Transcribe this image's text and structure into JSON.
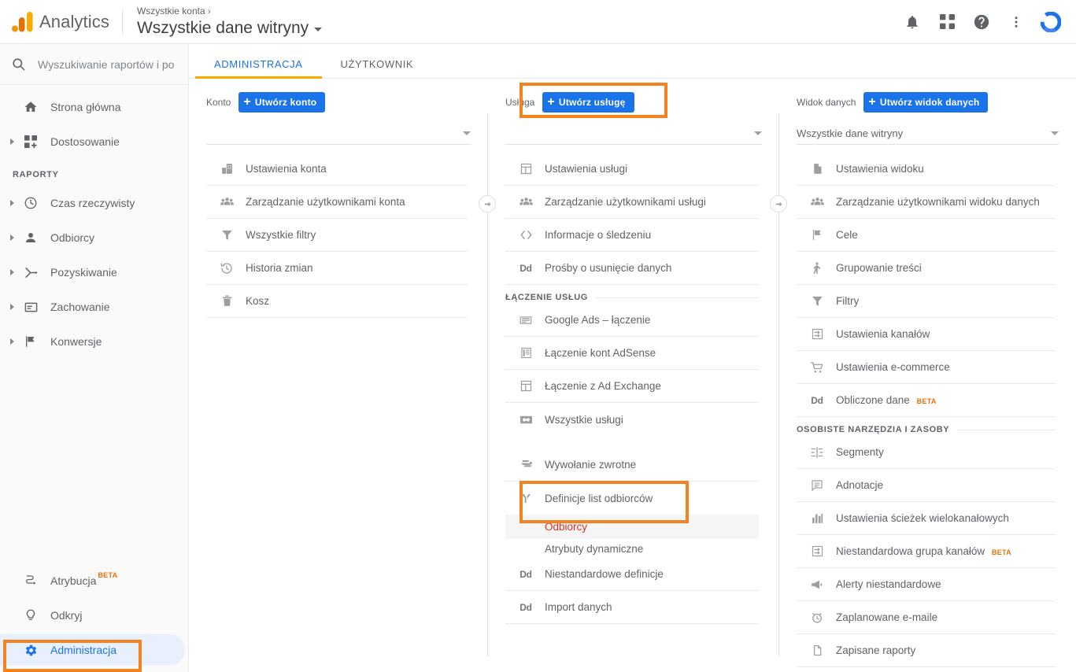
{
  "app": {
    "brand": "Analytics",
    "breadcrumb": "Wszystkie konta",
    "breadcrumb_chevron": "›",
    "view_title": "Wszystkie dane witryny",
    "accent_blue": "#1a73e8",
    "accent_orange": "#f58220",
    "highlight_color": "#f58220",
    "selected_text_color": "#d93025"
  },
  "topbar": {
    "icons": [
      {
        "name": "notifications-icon",
        "label": "Powiadomienia"
      },
      {
        "name": "apps-grid-icon",
        "label": "Aplikacje Google"
      },
      {
        "name": "help-icon",
        "label": "Pomoc"
      },
      {
        "name": "more-vert-icon",
        "label": "Więcej"
      },
      {
        "name": "avatar-icon",
        "label": "Konto Google"
      }
    ]
  },
  "search": {
    "placeholder": "Wyszukiwanie raportów i po",
    "value": ""
  },
  "sidebar": {
    "top_items": [
      {
        "label": "Strona główna",
        "icon": "home-icon",
        "expandable": false
      },
      {
        "label": "Dostosowanie",
        "icon": "customization-icon",
        "expandable": true
      }
    ],
    "section_label": "RAPORTY",
    "report_items": [
      {
        "label": "Czas rzeczywisty",
        "icon": "clock-icon",
        "expandable": true
      },
      {
        "label": "Odbiorcy",
        "icon": "person-icon",
        "expandable": true
      },
      {
        "label": "Pozyskiwanie",
        "icon": "acquisition-icon",
        "expandable": true
      },
      {
        "label": "Zachowanie",
        "icon": "behavior-icon",
        "expandable": true
      },
      {
        "label": "Konwersje",
        "icon": "flag-icon",
        "expandable": true
      }
    ],
    "bottom_items": [
      {
        "label": "Atrybucja",
        "icon": "attribution-icon",
        "badge": "BETA",
        "active": false
      },
      {
        "label": "Odkryj",
        "icon": "lightbulb-icon",
        "badge": "",
        "active": false
      },
      {
        "label": "Administracja",
        "icon": "gear-icon",
        "badge": "",
        "active": true
      }
    ]
  },
  "tabs": [
    {
      "label": "ADMINISTRACJA",
      "active": true
    },
    {
      "label": "UŻYTKOWNIK",
      "active": false
    }
  ],
  "columns": {
    "account": {
      "head_label": "Konto",
      "create_button": "Utwórz konto",
      "selector_value": "",
      "rows": [
        {
          "label": "Ustawienia konta",
          "icon": "building-icon"
        },
        {
          "label": "Zarządzanie użytkownikami konta",
          "icon": "people-icon"
        },
        {
          "label": "Wszystkie filtry",
          "icon": "filter-icon"
        },
        {
          "label": "Historia zmian",
          "icon": "history-icon"
        },
        {
          "label": "Kosz",
          "icon": "trash-icon"
        }
      ]
    },
    "property": {
      "head_label": "Usługa",
      "create_button": "Utwórz usługę",
      "selector_value": "",
      "rows": [
        {
          "label": "Ustawienia usługi",
          "icon": "layout-icon"
        },
        {
          "label": "Zarządzanie użytkownikami usługi",
          "icon": "people-icon"
        },
        {
          "label": "Informacje o śledzeniu",
          "icon": "code-icon"
        },
        {
          "label": "Prośby o usunięcie danych",
          "icon": "dd-icon"
        }
      ],
      "group_label": "ŁĄCZENIE USŁUG",
      "link_rows": [
        {
          "label": "Google Ads – łączenie",
          "icon": "ads-icon"
        },
        {
          "label": "Łączenie kont AdSense",
          "icon": "adsense-icon"
        },
        {
          "label": "Łączenie z Ad Exchange",
          "icon": "layout-icon"
        },
        {
          "label": "Wszystkie usługi",
          "icon": "link-icon"
        }
      ],
      "postback_row": {
        "label": "Wywołanie zwrotne",
        "icon": "postback-icon"
      },
      "audience_row": {
        "label": "Definicje list odbiorców",
        "icon": "branch-icon"
      },
      "audience_subrows": [
        {
          "label": "Odbiorcy",
          "selected": true
        },
        {
          "label": "Atrybuty dynamiczne",
          "selected": false
        }
      ],
      "tail_rows": [
        {
          "label": "Niestandardowe definicje",
          "icon": "dd-icon"
        },
        {
          "label": "Import danych",
          "icon": "dd-icon"
        }
      ]
    },
    "view": {
      "head_label": "Widok danych",
      "create_button": "Utwórz widok danych",
      "selector_value": "Wszystkie dane witryny",
      "rows": [
        {
          "label": "Ustawienia widoku",
          "icon": "document-icon",
          "badge": ""
        },
        {
          "label": "Zarządzanie użytkownikami widoku danych",
          "icon": "people-icon",
          "badge": ""
        },
        {
          "label": "Cele",
          "icon": "flag-icon",
          "badge": ""
        },
        {
          "label": "Grupowanie treści",
          "icon": "content-group-icon",
          "badge": ""
        },
        {
          "label": "Filtry",
          "icon": "filter-icon",
          "badge": ""
        },
        {
          "label": "Ustawienia kanałów",
          "icon": "channel-icon",
          "badge": ""
        },
        {
          "label": "Ustawienia e-commerce",
          "icon": "cart-icon",
          "badge": ""
        },
        {
          "label": "Obliczone dane",
          "icon": "dd-icon",
          "badge": "BETA"
        }
      ],
      "group_label": "OSOBISTE NARZĘDZIA I ZASOBY",
      "tools_rows": [
        {
          "label": "Segmenty",
          "icon": "segments-icon",
          "badge": ""
        },
        {
          "label": "Adnotacje",
          "icon": "annotation-icon",
          "badge": ""
        },
        {
          "label": "Ustawienia ścieżek wielokanałowych",
          "icon": "bars-icon",
          "badge": ""
        },
        {
          "label": "Niestandardowa grupa kanałów",
          "icon": "channel-icon",
          "badge": "BETA"
        },
        {
          "label": "Alerty niestandardowe",
          "icon": "megaphone-icon",
          "badge": ""
        },
        {
          "label": "Zaplanowane e-maile",
          "icon": "alarm-icon",
          "badge": ""
        },
        {
          "label": "Zapisane raporty",
          "icon": "document-icon",
          "badge": ""
        }
      ]
    }
  },
  "highlights": [
    {
      "name": "highlight-create-property",
      "target": "Utwórz usługę"
    },
    {
      "name": "highlight-audience-definitions",
      "target": "Definicje list odbiorców / Odbiorcy"
    },
    {
      "name": "highlight-admin-nav",
      "target": "Administracja"
    }
  ]
}
